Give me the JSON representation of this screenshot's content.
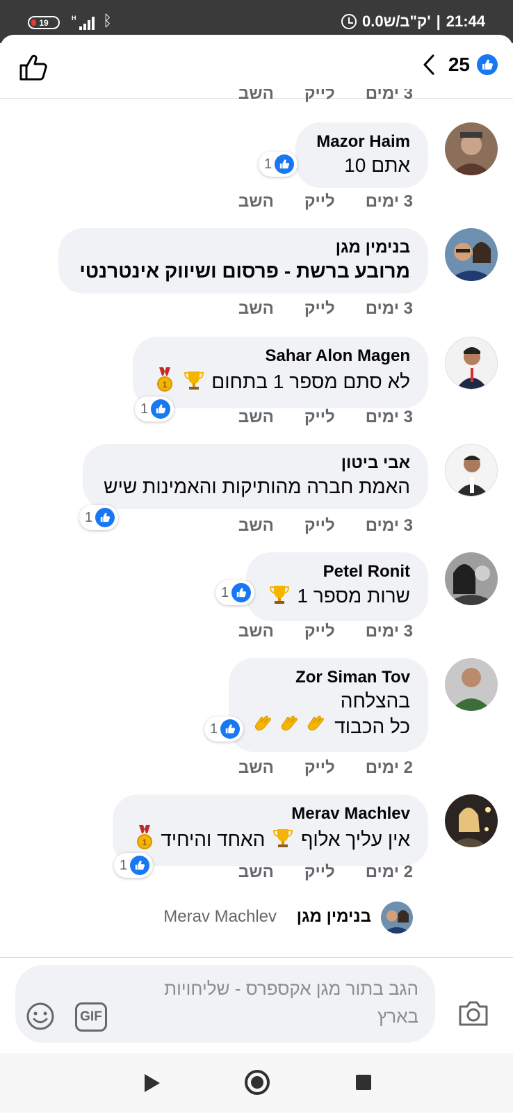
{
  "status_bar": {
    "battery": "19",
    "network": "H",
    "data_rate": "0.0ק\"ב/ש'",
    "time": "21:44"
  },
  "header": {
    "like_count": "25"
  },
  "actions": {
    "like": "לייק",
    "reply": "השב"
  },
  "comments": [
    {
      "author": "Mazor Haim",
      "lines": [
        "אתם 10"
      ],
      "time": "3 ימים",
      "reactions": "1"
    },
    {
      "author": "בנימין מגן",
      "lines": [
        "מרובע ברשת - פרסום ושיווק אינטרנטי"
      ],
      "time": "3 ימים",
      "reactions": ""
    },
    {
      "author": "Sahar Alon Magen",
      "lines": [
        "לא סתם מספר 1 בתחום"
      ],
      "time": "3 ימים",
      "reactions": "1"
    },
    {
      "author": "אבי ביטון",
      "lines": [
        "האמת חברה מהותיקות והאמינות שיש"
      ],
      "time": "3 ימים",
      "reactions": "1"
    },
    {
      "author": "Petel Ronit",
      "lines": [
        "שרות מספר 1"
      ],
      "time": "3 ימים",
      "reactions": "1"
    },
    {
      "author": "Zor Siman Tov",
      "lines": [
        "בהצלחה",
        "כל הכבוד"
      ],
      "time": "2 ימים",
      "reactions": "1"
    },
    {
      "author": "Merav Machlev",
      "lines": [
        "אין עליך אלוף",
        "האחד והיחיד"
      ],
      "time": "2 ימים",
      "reactions": "1"
    }
  ],
  "reply_preview": {
    "author": "בנימין מגן",
    "replying_to": "Merav Machlev"
  },
  "composer": {
    "placeholder": "הגב בתור מגן אקספרס - שליחויות בארץ",
    "gif_label": "GIF"
  },
  "colors": {
    "accent": "#1877f2",
    "bubble": "#f0f2f5",
    "meta_text": "#65676b"
  }
}
